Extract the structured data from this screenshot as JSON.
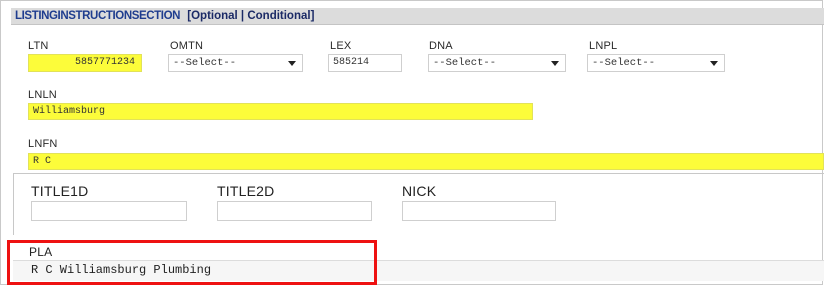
{
  "section": {
    "name": "LISTINGINSTRUCTIONSECTION",
    "qualifier": "[Optional | Conditional]"
  },
  "row1": {
    "ltn": {
      "label": "LTN",
      "value": "5857771234"
    },
    "omtn": {
      "label": "OMTN",
      "selected": "--Select--"
    },
    "lex": {
      "label": "LEX",
      "value": "585214"
    },
    "dna": {
      "label": "DNA",
      "selected": "--Select--"
    },
    "lnpl": {
      "label": "LNPL",
      "selected": "--Select--"
    }
  },
  "lnln": {
    "label": "LNLN",
    "value": "Williamsburg"
  },
  "lnfn": {
    "label": "LNFN",
    "value": "R C"
  },
  "titles": {
    "title1d": {
      "label": "TITLE1D",
      "value": ""
    },
    "title2d": {
      "label": "TITLE2D",
      "value": ""
    },
    "nick": {
      "label": "NICK",
      "value": ""
    }
  },
  "pla": {
    "label": "PLA",
    "value": "R C Williamsburg Plumbing"
  },
  "colors": {
    "highlight": "#fcfc3a",
    "header_text": "#1f3d8f",
    "annotation_box": "#ee1111"
  }
}
